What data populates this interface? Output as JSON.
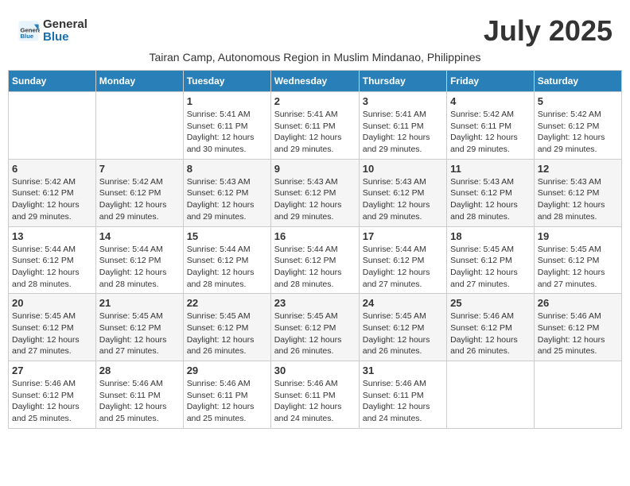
{
  "header": {
    "logo_general": "General",
    "logo_blue": "Blue",
    "month_title": "July 2025",
    "subtitle": "Tairan Camp, Autonomous Region in Muslim Mindanao, Philippines"
  },
  "days_of_week": [
    "Sunday",
    "Monday",
    "Tuesday",
    "Wednesday",
    "Thursday",
    "Friday",
    "Saturday"
  ],
  "weeks": [
    [
      {
        "day": "",
        "info": ""
      },
      {
        "day": "",
        "info": ""
      },
      {
        "day": "1",
        "info": "Sunrise: 5:41 AM\nSunset: 6:11 PM\nDaylight: 12 hours and 30 minutes."
      },
      {
        "day": "2",
        "info": "Sunrise: 5:41 AM\nSunset: 6:11 PM\nDaylight: 12 hours and 29 minutes."
      },
      {
        "day": "3",
        "info": "Sunrise: 5:41 AM\nSunset: 6:11 PM\nDaylight: 12 hours and 29 minutes."
      },
      {
        "day": "4",
        "info": "Sunrise: 5:42 AM\nSunset: 6:11 PM\nDaylight: 12 hours and 29 minutes."
      },
      {
        "day": "5",
        "info": "Sunrise: 5:42 AM\nSunset: 6:12 PM\nDaylight: 12 hours and 29 minutes."
      }
    ],
    [
      {
        "day": "6",
        "info": "Sunrise: 5:42 AM\nSunset: 6:12 PM\nDaylight: 12 hours and 29 minutes."
      },
      {
        "day": "7",
        "info": "Sunrise: 5:42 AM\nSunset: 6:12 PM\nDaylight: 12 hours and 29 minutes."
      },
      {
        "day": "8",
        "info": "Sunrise: 5:43 AM\nSunset: 6:12 PM\nDaylight: 12 hours and 29 minutes."
      },
      {
        "day": "9",
        "info": "Sunrise: 5:43 AM\nSunset: 6:12 PM\nDaylight: 12 hours and 29 minutes."
      },
      {
        "day": "10",
        "info": "Sunrise: 5:43 AM\nSunset: 6:12 PM\nDaylight: 12 hours and 29 minutes."
      },
      {
        "day": "11",
        "info": "Sunrise: 5:43 AM\nSunset: 6:12 PM\nDaylight: 12 hours and 28 minutes."
      },
      {
        "day": "12",
        "info": "Sunrise: 5:43 AM\nSunset: 6:12 PM\nDaylight: 12 hours and 28 minutes."
      }
    ],
    [
      {
        "day": "13",
        "info": "Sunrise: 5:44 AM\nSunset: 6:12 PM\nDaylight: 12 hours and 28 minutes."
      },
      {
        "day": "14",
        "info": "Sunrise: 5:44 AM\nSunset: 6:12 PM\nDaylight: 12 hours and 28 minutes."
      },
      {
        "day": "15",
        "info": "Sunrise: 5:44 AM\nSunset: 6:12 PM\nDaylight: 12 hours and 28 minutes."
      },
      {
        "day": "16",
        "info": "Sunrise: 5:44 AM\nSunset: 6:12 PM\nDaylight: 12 hours and 28 minutes."
      },
      {
        "day": "17",
        "info": "Sunrise: 5:44 AM\nSunset: 6:12 PM\nDaylight: 12 hours and 27 minutes."
      },
      {
        "day": "18",
        "info": "Sunrise: 5:45 AM\nSunset: 6:12 PM\nDaylight: 12 hours and 27 minutes."
      },
      {
        "day": "19",
        "info": "Sunrise: 5:45 AM\nSunset: 6:12 PM\nDaylight: 12 hours and 27 minutes."
      }
    ],
    [
      {
        "day": "20",
        "info": "Sunrise: 5:45 AM\nSunset: 6:12 PM\nDaylight: 12 hours and 27 minutes."
      },
      {
        "day": "21",
        "info": "Sunrise: 5:45 AM\nSunset: 6:12 PM\nDaylight: 12 hours and 27 minutes."
      },
      {
        "day": "22",
        "info": "Sunrise: 5:45 AM\nSunset: 6:12 PM\nDaylight: 12 hours and 26 minutes."
      },
      {
        "day": "23",
        "info": "Sunrise: 5:45 AM\nSunset: 6:12 PM\nDaylight: 12 hours and 26 minutes."
      },
      {
        "day": "24",
        "info": "Sunrise: 5:45 AM\nSunset: 6:12 PM\nDaylight: 12 hours and 26 minutes."
      },
      {
        "day": "25",
        "info": "Sunrise: 5:46 AM\nSunset: 6:12 PM\nDaylight: 12 hours and 26 minutes."
      },
      {
        "day": "26",
        "info": "Sunrise: 5:46 AM\nSunset: 6:12 PM\nDaylight: 12 hours and 25 minutes."
      }
    ],
    [
      {
        "day": "27",
        "info": "Sunrise: 5:46 AM\nSunset: 6:12 PM\nDaylight: 12 hours and 25 minutes."
      },
      {
        "day": "28",
        "info": "Sunrise: 5:46 AM\nSunset: 6:11 PM\nDaylight: 12 hours and 25 minutes."
      },
      {
        "day": "29",
        "info": "Sunrise: 5:46 AM\nSunset: 6:11 PM\nDaylight: 12 hours and 25 minutes."
      },
      {
        "day": "30",
        "info": "Sunrise: 5:46 AM\nSunset: 6:11 PM\nDaylight: 12 hours and 24 minutes."
      },
      {
        "day": "31",
        "info": "Sunrise: 5:46 AM\nSunset: 6:11 PM\nDaylight: 12 hours and 24 minutes."
      },
      {
        "day": "",
        "info": ""
      },
      {
        "day": "",
        "info": ""
      }
    ]
  ]
}
